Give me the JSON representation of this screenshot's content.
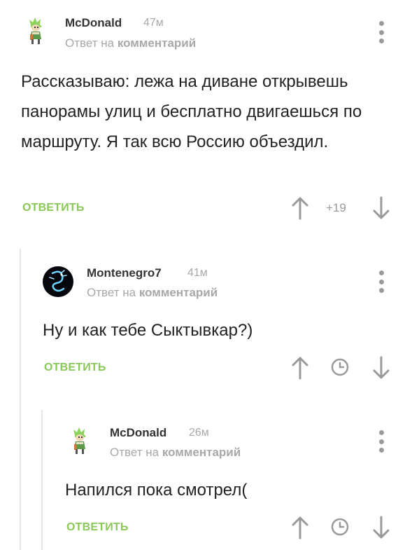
{
  "comments": [
    {
      "username": "McDonald",
      "time": "47м",
      "reply_prefix": "Ответ на",
      "reply_target": "комментарий",
      "text": "Рассказываю: лежа на диване открывешь панорамы улиц и бесплатно двигаешься по маршруту. Я так всю Россию объездил.",
      "reply_label": "ОТВЕТИТЬ",
      "rating": "+19",
      "avatar_icon": "anime-character-avatar"
    },
    {
      "username": "Montenegro7",
      "time": "41м",
      "reply_prefix": "Ответ на",
      "reply_target": "комментарий",
      "text": "Ну и как тебе Сыктывкар?)",
      "reply_label": "ОТВЕТИТЬ",
      "avatar_icon": "glowing-dragon-avatar"
    },
    {
      "username": "McDonald",
      "time": "26м",
      "reply_prefix": "Ответ на",
      "reply_target": "комментарий",
      "text": "Напился пока смотрел(",
      "reply_label": "ОТВЕТИТЬ",
      "avatar_icon": "anime-character-avatar"
    }
  ],
  "colors": {
    "accent_green": "#8ac858",
    "muted_gray": "#a8a8a8",
    "text_dark": "#222222",
    "thread_line": "#e6e6e6"
  }
}
